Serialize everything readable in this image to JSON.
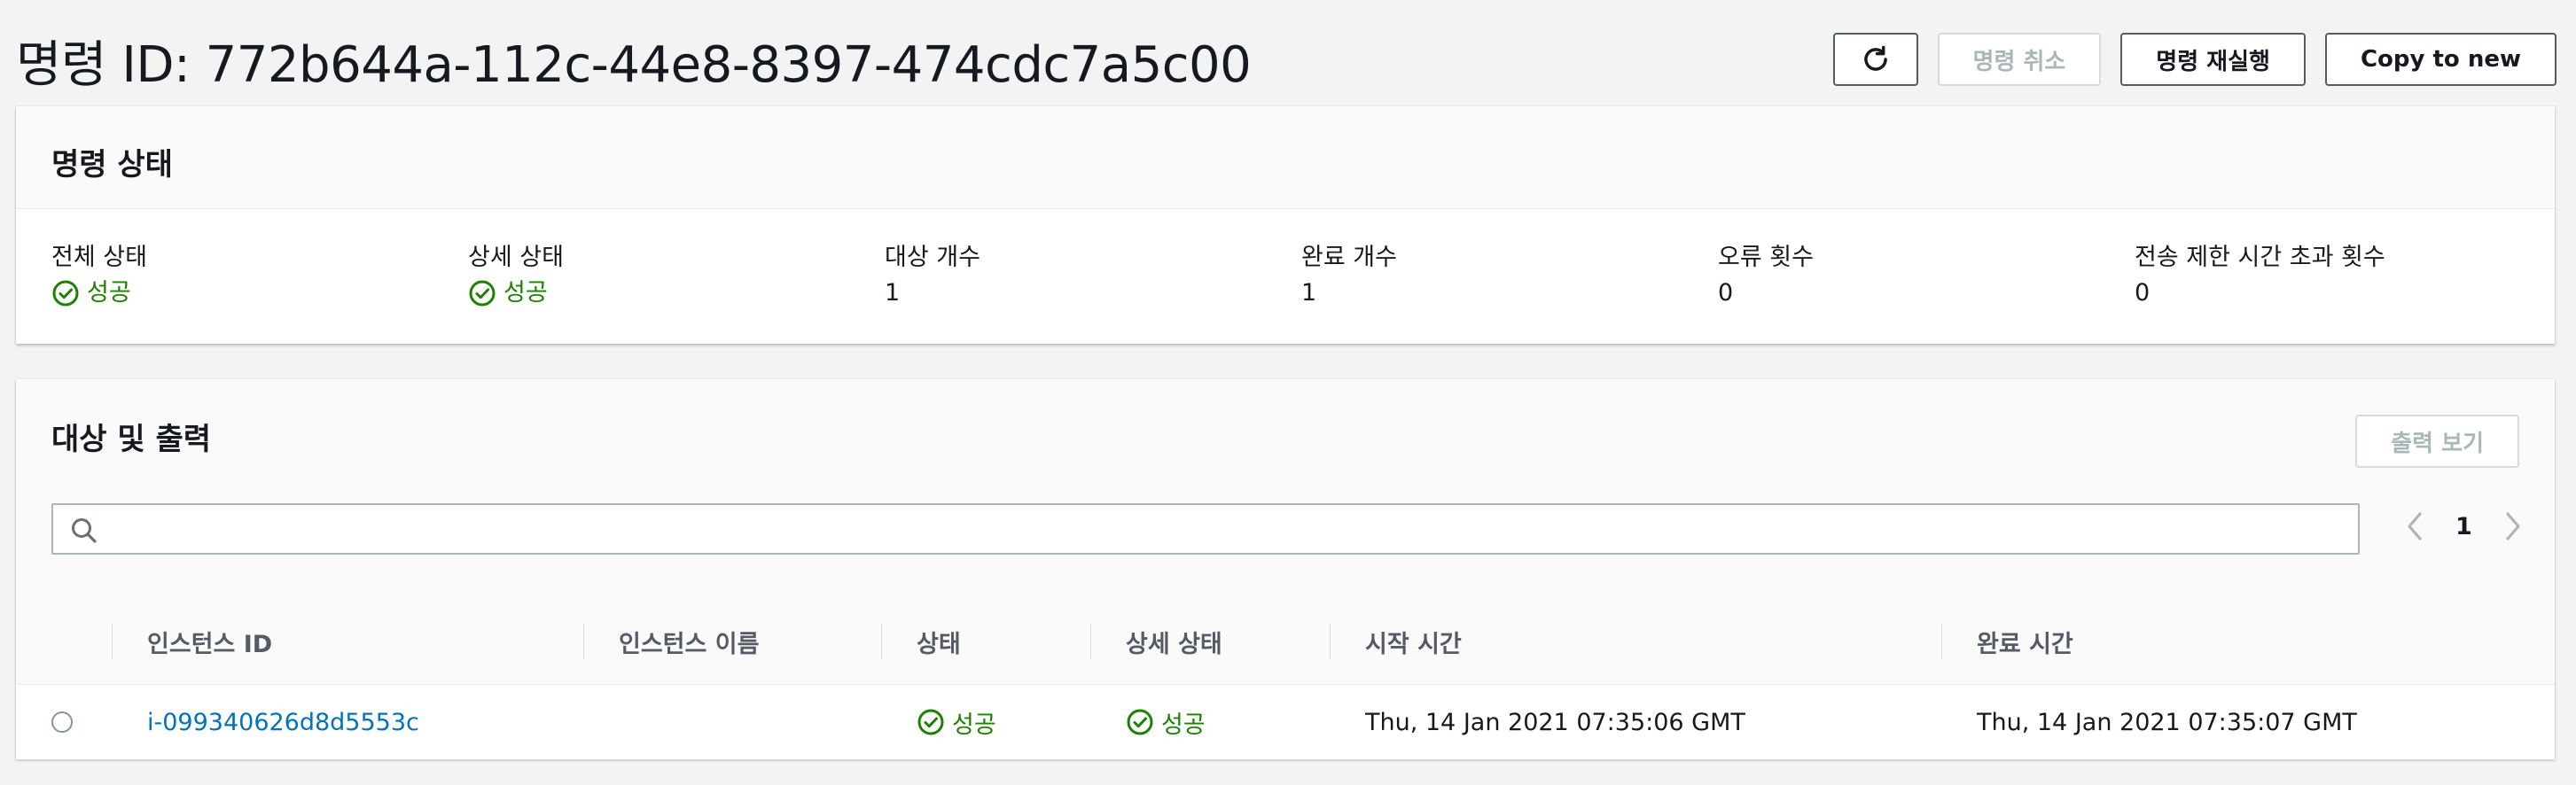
{
  "header": {
    "title": "명령 ID: 772b644a-112c-44e8-8397-474cdc7a5c00",
    "cancel_label": "명령 취소",
    "rerun_label": "명령 재실행",
    "copy_label": "Copy to new"
  },
  "status_panel": {
    "title": "명령 상태",
    "items": [
      {
        "label": "전체 상태",
        "value": "성공"
      },
      {
        "label": "상세 상태",
        "value": "성공"
      },
      {
        "label": "대상 개수",
        "value": "1"
      },
      {
        "label": "완료 개수",
        "value": "1"
      },
      {
        "label": "오류 횟수",
        "value": "0"
      },
      {
        "label": "전송 제한 시간 초과 횟수",
        "value": "0"
      }
    ]
  },
  "targets_panel": {
    "title": "대상 및 출력",
    "view_output_label": "출력 보기",
    "search": {
      "placeholder": "",
      "value": ""
    },
    "page_number": "1",
    "columns": [
      "인스턴스 ID",
      "인스턴스 이름",
      "상태",
      "상세 상태",
      "시작 시간",
      "완료 시간"
    ],
    "rows": [
      {
        "instance_id": "i-099340626d8d5553c",
        "instance_name": "",
        "status": "성공",
        "detail_status": "성공",
        "start_time": "Thu, 14 Jan 2021 07:35:06 GMT",
        "end_time": "Thu, 14 Jan 2021 07:35:07 GMT"
      }
    ]
  },
  "colors": {
    "success": "#1d8102",
    "link": "#0073bb",
    "disabled": "#aab7b8",
    "background": "#f2f3f3"
  },
  "icons": [
    "refresh-icon",
    "success-icon",
    "search-icon",
    "chevron-left-icon",
    "chevron-right-icon"
  ]
}
